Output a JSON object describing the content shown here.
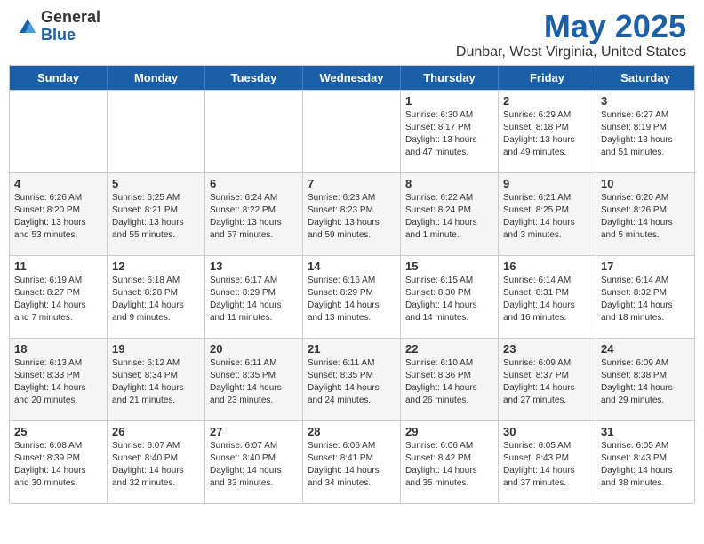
{
  "header": {
    "logo": {
      "general": "General",
      "blue": "Blue"
    },
    "title": "May 2025",
    "location": "Dunbar, West Virginia, United States"
  },
  "calendar": {
    "weekdays": [
      "Sunday",
      "Monday",
      "Tuesday",
      "Wednesday",
      "Thursday",
      "Friday",
      "Saturday"
    ],
    "weeks": [
      [
        {
          "day": "",
          "sunrise": "",
          "sunset": "",
          "daylight": ""
        },
        {
          "day": "",
          "sunrise": "",
          "sunset": "",
          "daylight": ""
        },
        {
          "day": "",
          "sunrise": "",
          "sunset": "",
          "daylight": ""
        },
        {
          "day": "",
          "sunrise": "",
          "sunset": "",
          "daylight": ""
        },
        {
          "day": "1",
          "sunrise": "Sunrise: 6:30 AM",
          "sunset": "Sunset: 8:17 PM",
          "daylight": "Daylight: 13 hours and 47 minutes."
        },
        {
          "day": "2",
          "sunrise": "Sunrise: 6:29 AM",
          "sunset": "Sunset: 8:18 PM",
          "daylight": "Daylight: 13 hours and 49 minutes."
        },
        {
          "day": "3",
          "sunrise": "Sunrise: 6:27 AM",
          "sunset": "Sunset: 8:19 PM",
          "daylight": "Daylight: 13 hours and 51 minutes."
        }
      ],
      [
        {
          "day": "4",
          "sunrise": "Sunrise: 6:26 AM",
          "sunset": "Sunset: 8:20 PM",
          "daylight": "Daylight: 13 hours and 53 minutes."
        },
        {
          "day": "5",
          "sunrise": "Sunrise: 6:25 AM",
          "sunset": "Sunset: 8:21 PM",
          "daylight": "Daylight: 13 hours and 55 minutes."
        },
        {
          "day": "6",
          "sunrise": "Sunrise: 6:24 AM",
          "sunset": "Sunset: 8:22 PM",
          "daylight": "Daylight: 13 hours and 57 minutes."
        },
        {
          "day": "7",
          "sunrise": "Sunrise: 6:23 AM",
          "sunset": "Sunset: 8:23 PM",
          "daylight": "Daylight: 13 hours and 59 minutes."
        },
        {
          "day": "8",
          "sunrise": "Sunrise: 6:22 AM",
          "sunset": "Sunset: 8:24 PM",
          "daylight": "Daylight: 14 hours and 1 minute."
        },
        {
          "day": "9",
          "sunrise": "Sunrise: 6:21 AM",
          "sunset": "Sunset: 8:25 PM",
          "daylight": "Daylight: 14 hours and 3 minutes."
        },
        {
          "day": "10",
          "sunrise": "Sunrise: 6:20 AM",
          "sunset": "Sunset: 8:26 PM",
          "daylight": "Daylight: 14 hours and 5 minutes."
        }
      ],
      [
        {
          "day": "11",
          "sunrise": "Sunrise: 6:19 AM",
          "sunset": "Sunset: 8:27 PM",
          "daylight": "Daylight: 14 hours and 7 minutes."
        },
        {
          "day": "12",
          "sunrise": "Sunrise: 6:18 AM",
          "sunset": "Sunset: 8:28 PM",
          "daylight": "Daylight: 14 hours and 9 minutes."
        },
        {
          "day": "13",
          "sunrise": "Sunrise: 6:17 AM",
          "sunset": "Sunset: 8:29 PM",
          "daylight": "Daylight: 14 hours and 11 minutes."
        },
        {
          "day": "14",
          "sunrise": "Sunrise: 6:16 AM",
          "sunset": "Sunset: 8:29 PM",
          "daylight": "Daylight: 14 hours and 13 minutes."
        },
        {
          "day": "15",
          "sunrise": "Sunrise: 6:15 AM",
          "sunset": "Sunset: 8:30 PM",
          "daylight": "Daylight: 14 hours and 14 minutes."
        },
        {
          "day": "16",
          "sunrise": "Sunrise: 6:14 AM",
          "sunset": "Sunset: 8:31 PM",
          "daylight": "Daylight: 14 hours and 16 minutes."
        },
        {
          "day": "17",
          "sunrise": "Sunrise: 6:14 AM",
          "sunset": "Sunset: 8:32 PM",
          "daylight": "Daylight: 14 hours and 18 minutes."
        }
      ],
      [
        {
          "day": "18",
          "sunrise": "Sunrise: 6:13 AM",
          "sunset": "Sunset: 8:33 PM",
          "daylight": "Daylight: 14 hours and 20 minutes."
        },
        {
          "day": "19",
          "sunrise": "Sunrise: 6:12 AM",
          "sunset": "Sunset: 8:34 PM",
          "daylight": "Daylight: 14 hours and 21 minutes."
        },
        {
          "day": "20",
          "sunrise": "Sunrise: 6:11 AM",
          "sunset": "Sunset: 8:35 PM",
          "daylight": "Daylight: 14 hours and 23 minutes."
        },
        {
          "day": "21",
          "sunrise": "Sunrise: 6:11 AM",
          "sunset": "Sunset: 8:35 PM",
          "daylight": "Daylight: 14 hours and 24 minutes."
        },
        {
          "day": "22",
          "sunrise": "Sunrise: 6:10 AM",
          "sunset": "Sunset: 8:36 PM",
          "daylight": "Daylight: 14 hours and 26 minutes."
        },
        {
          "day": "23",
          "sunrise": "Sunrise: 6:09 AM",
          "sunset": "Sunset: 8:37 PM",
          "daylight": "Daylight: 14 hours and 27 minutes."
        },
        {
          "day": "24",
          "sunrise": "Sunrise: 6:09 AM",
          "sunset": "Sunset: 8:38 PM",
          "daylight": "Daylight: 14 hours and 29 minutes."
        }
      ],
      [
        {
          "day": "25",
          "sunrise": "Sunrise: 6:08 AM",
          "sunset": "Sunset: 8:39 PM",
          "daylight": "Daylight: 14 hours and 30 minutes."
        },
        {
          "day": "26",
          "sunrise": "Sunrise: 6:07 AM",
          "sunset": "Sunset: 8:40 PM",
          "daylight": "Daylight: 14 hours and 32 minutes."
        },
        {
          "day": "27",
          "sunrise": "Sunrise: 6:07 AM",
          "sunset": "Sunset: 8:40 PM",
          "daylight": "Daylight: 14 hours and 33 minutes."
        },
        {
          "day": "28",
          "sunrise": "Sunrise: 6:06 AM",
          "sunset": "Sunset: 8:41 PM",
          "daylight": "Daylight: 14 hours and 34 minutes."
        },
        {
          "day": "29",
          "sunrise": "Sunrise: 6:06 AM",
          "sunset": "Sunset: 8:42 PM",
          "daylight": "Daylight: 14 hours and 35 minutes."
        },
        {
          "day": "30",
          "sunrise": "Sunrise: 6:05 AM",
          "sunset": "Sunset: 8:43 PM",
          "daylight": "Daylight: 14 hours and 37 minutes."
        },
        {
          "day": "31",
          "sunrise": "Sunrise: 6:05 AM",
          "sunset": "Sunset: 8:43 PM",
          "daylight": "Daylight: 14 hours and 38 minutes."
        }
      ]
    ]
  }
}
